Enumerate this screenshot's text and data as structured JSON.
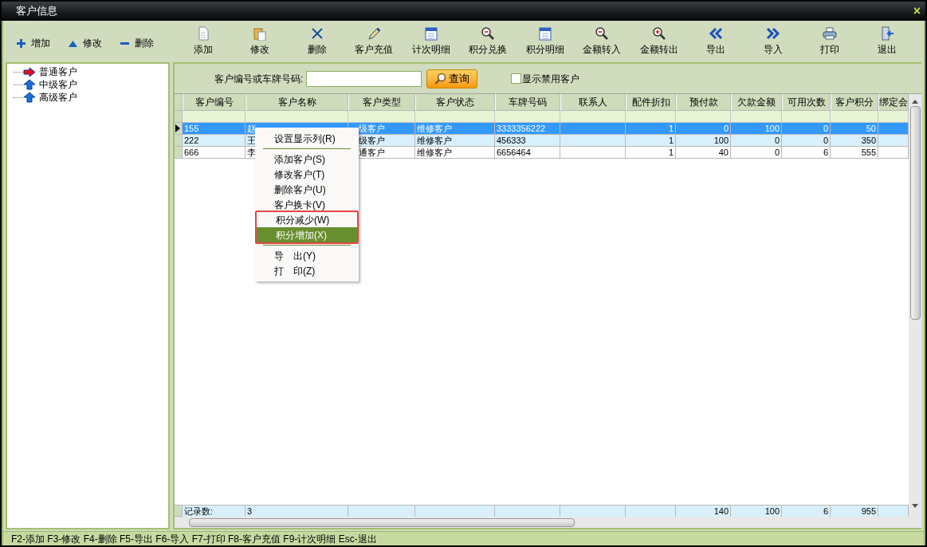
{
  "window": {
    "title": "客户信息",
    "close": "×"
  },
  "side_toolbar": [
    {
      "label": "增加"
    },
    {
      "label": "修改"
    },
    {
      "label": "删除"
    }
  ],
  "toolbar": [
    {
      "label": "添加"
    },
    {
      "label": "修改"
    },
    {
      "label": "删除"
    },
    {
      "label": "客户充值"
    },
    {
      "label": "计次明细"
    },
    {
      "label": "积分兑换"
    },
    {
      "label": "积分明细"
    },
    {
      "label": "金额转入"
    },
    {
      "label": "金额转出"
    },
    {
      "label": "导出"
    },
    {
      "label": "导入"
    },
    {
      "label": "打印"
    },
    {
      "label": "退出"
    }
  ],
  "tree": [
    {
      "label": "普通客户",
      "selected": true
    },
    {
      "label": "中级客户",
      "selected": false
    },
    {
      "label": "高级客户",
      "selected": false
    }
  ],
  "search": {
    "label": "客户编号或车牌号码:",
    "button": "查询",
    "show_disabled": {
      "label": "显示禁用客户",
      "checked": false
    }
  },
  "table": {
    "columns": [
      "客户编号",
      "客户名称",
      "客户类型",
      "客户状态",
      "车牌号码",
      "联系人",
      "配件折扣",
      "预付款",
      "欠款金额",
      "可用次数",
      "客户积分",
      "绑定会"
    ],
    "rows": [
      {
        "selected": true,
        "cells": [
          "155",
          "赵",
          "级客户",
          "维修客户",
          "3333356222",
          null,
          "1",
          "0",
          "100",
          "0",
          "50",
          null
        ]
      },
      {
        "selected": false,
        "cells": [
          "222",
          "王",
          "级客户",
          "维修客户",
          "456333",
          null,
          "1",
          "100",
          "0",
          "0",
          "350",
          null
        ]
      },
      {
        "selected": false,
        "cells": [
          "666",
          "李",
          "通客户",
          "维修客户",
          "6656464",
          null,
          "1",
          "40",
          "0",
          "6",
          "555",
          null
        ]
      }
    ],
    "footer": {
      "label": "记录数:",
      "count": "3",
      "prepaid": "140",
      "debt": "100",
      "uses": "6",
      "points": "955"
    }
  },
  "context_menu": [
    {
      "kind": "item",
      "label": "设置显示列(R)",
      "selected": false
    },
    {
      "kind": "separator"
    },
    {
      "kind": "item",
      "label": "添加客户(S)",
      "selected": false
    },
    {
      "kind": "item",
      "label": "修改客户(T)",
      "selected": false
    },
    {
      "kind": "item",
      "label": "删除客户(U)",
      "selected": false
    },
    {
      "kind": "item",
      "label": "客户换卡(V)",
      "selected": false
    },
    {
      "kind": "item",
      "label": "积分减少(W)",
      "selected": false,
      "framed": true
    },
    {
      "kind": "item",
      "label": "积分增加(X)",
      "selected": true,
      "framed": true
    },
    {
      "kind": "separator"
    },
    {
      "kind": "item",
      "label": "导　出(Y)",
      "selected": false
    },
    {
      "kind": "item",
      "label": "打　印(Z)",
      "selected": false
    }
  ],
  "status_bar": "F2-添加 F3-修改 F4-删除 F5-导出 F6-导入 F7-打印 F8-客户充值 F9-计次明细 Esc-退出"
}
